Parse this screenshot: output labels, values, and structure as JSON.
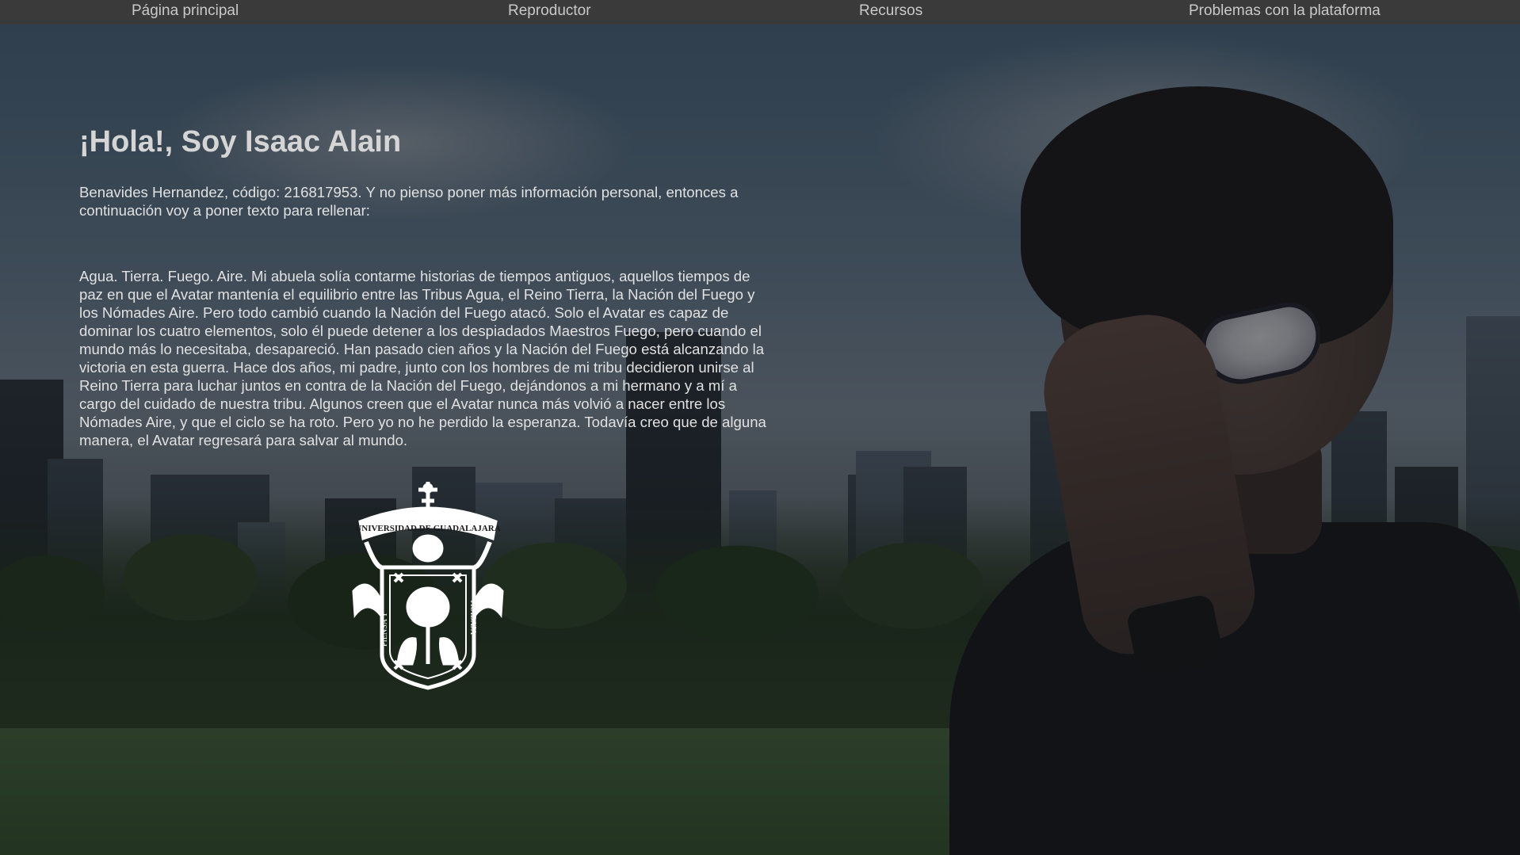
{
  "nav": {
    "items": [
      {
        "label": "Página principal"
      },
      {
        "label": "Reproductor"
      },
      {
        "label": "Recursos"
      },
      {
        "label": "Problemas con la plataforma"
      }
    ]
  },
  "main": {
    "title": "¡Hola!, Soy Isaac Alain",
    "intro": "Benavides Hernandez, código: 216817953. Y no pienso poner más información personal, entonces a continuación voy a poner texto para rellenar:",
    "story": "Agua. Tierra. Fuego. Aire. Mi abuela solía contarme historias de tiempos antiguos, aquellos tiempos de paz en que el Avatar mantenía el equilibrio entre las Tribus Agua, el Reino Tierra, la Nación del Fuego y los Nómades Aire. Pero todo cambió cuando la Nación del Fuego atacó. Solo el Avatar es capaz de dominar los cuatro elementos, solo él puede detener a los despiadados Maestros Fuego, pero cuando el mundo más lo necesitaba, desapareció. Han pasado cien años y la Nación del Fuego está alcanzando la victoria en esta guerra. Hace dos años, mi padre, junto con los hombres de mi tribu decidieron unirse al Reino Tierra para luchar juntos en contra de la Nación del Fuego, dejándonos a mi hermano y a mí a cargo del cuidado de nuestra tribu. Algunos creen que el Avatar nunca más volvió a nacer entre los Nómades Aire, y que el ciclo se ha roto. Pero yo no he perdido la esperanza. Todavía creo que de alguna manera, el Avatar regresará para salvar al mundo."
  },
  "crest": {
    "icon": "universidad-de-guadalajara-crest-icon",
    "banner_text": "UNIVERSIDAD DE GUADALAJARA",
    "left_text": "PIENSA Y",
    "right_text": "TRABAJA"
  },
  "colors": {
    "navbar": "#3a3a3a",
    "nav_text": "#c9c9c9",
    "title": "#d5d5d5",
    "body_text": "#e1e1e1",
    "overlay": "rgba(20,22,25,0.55)"
  }
}
